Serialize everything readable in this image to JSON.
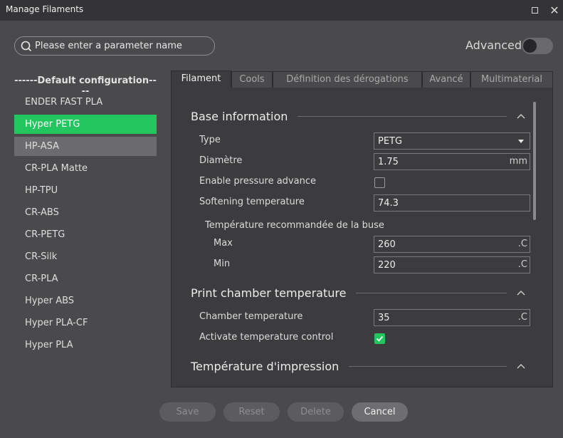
{
  "window": {
    "title": "Manage Filaments"
  },
  "search": {
    "placeholder": "Please enter a parameter name"
  },
  "advanced": {
    "label": "Advanced",
    "enabled": false
  },
  "left": {
    "header": "------Default configuration----",
    "items": [
      "ENDER FAST PLA",
      "Hyper PETG",
      "HP-ASA",
      "CR-PLA Matte",
      "HP-TPU",
      "CR-ABS",
      "CR-PETG",
      "CR-Silk",
      "CR-PLA",
      "Hyper ABS",
      "Hyper PLA-CF",
      "Hyper PLA"
    ],
    "selected": "Hyper PETG",
    "hovered": "HP-ASA"
  },
  "tabs": [
    "Filament",
    "Cools",
    "Définition des dérogations",
    "Avancé",
    "Multimaterial"
  ],
  "active_tab": "Filament",
  "sections": {
    "base": {
      "title": "Base information",
      "type_label": "Type",
      "type_value": "PETG",
      "diameter_label": "Diamètre",
      "diameter_value": "1.75",
      "diameter_unit": "mm",
      "pressure_label": "Enable pressure advance",
      "pressure_checked": false,
      "softening_label": "Softening temperature",
      "softening_value": "74.3",
      "nozzle_group_label": "Température recommandée de la buse",
      "max_label": "Max",
      "max_value": "260",
      "max_unit": ".C",
      "min_label": "Min",
      "min_value": "220",
      "min_unit": ".C"
    },
    "chamber": {
      "title": "Print chamber temperature",
      "chamber_label": "Chamber temperature",
      "chamber_value": "35",
      "chamber_unit": ".C",
      "activate_label": "Activate temperature control",
      "activate_checked": true
    },
    "print_temp": {
      "title": "Température d'impression"
    }
  },
  "buttons": {
    "save": "Save",
    "reset": "Reset",
    "delete": "Delete",
    "cancel": "Cancel"
  },
  "colors": {
    "accent": "#22c55e",
    "background": "#4a4a4c",
    "panel": "#3c3c3e"
  }
}
